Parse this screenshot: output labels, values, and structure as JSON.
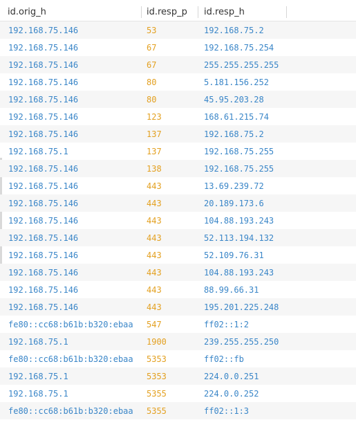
{
  "columns": {
    "orig_h": "id.orig_h",
    "resp_p": "id.resp_p",
    "resp_h": "id.resp_h"
  },
  "colors": {
    "ip": "#3a86c8",
    "port": "#e3a020",
    "header_text": "#333333"
  },
  "rows": [
    {
      "orig_h": "192.168.75.146",
      "resp_p": "53",
      "resp_h": "192.168.75.2"
    },
    {
      "orig_h": "192.168.75.146",
      "resp_p": "67",
      "resp_h": "192.168.75.254"
    },
    {
      "orig_h": "192.168.75.146",
      "resp_p": "67",
      "resp_h": "255.255.255.255"
    },
    {
      "orig_h": "192.168.75.146",
      "resp_p": "80",
      "resp_h": "5.181.156.252"
    },
    {
      "orig_h": "192.168.75.146",
      "resp_p": "80",
      "resp_h": "45.95.203.28"
    },
    {
      "orig_h": "192.168.75.146",
      "resp_p": "123",
      "resp_h": "168.61.215.74"
    },
    {
      "orig_h": "192.168.75.146",
      "resp_p": "137",
      "resp_h": "192.168.75.2"
    },
    {
      "orig_h": "192.168.75.1",
      "resp_p": "137",
      "resp_h": "192.168.75.255"
    },
    {
      "orig_h": "192.168.75.146",
      "resp_p": "138",
      "resp_h": "192.168.75.255"
    },
    {
      "orig_h": "192.168.75.146",
      "resp_p": "443",
      "resp_h": "13.69.239.72"
    },
    {
      "orig_h": "192.168.75.146",
      "resp_p": "443",
      "resp_h": "20.189.173.6"
    },
    {
      "orig_h": "192.168.75.146",
      "resp_p": "443",
      "resp_h": "104.88.193.243"
    },
    {
      "orig_h": "192.168.75.146",
      "resp_p": "443",
      "resp_h": "52.113.194.132"
    },
    {
      "orig_h": "192.168.75.146",
      "resp_p": "443",
      "resp_h": "52.109.76.31"
    },
    {
      "orig_h": "192.168.75.146",
      "resp_p": "443",
      "resp_h": "104.88.193.243"
    },
    {
      "orig_h": "192.168.75.146",
      "resp_p": "443",
      "resp_h": "88.99.66.31"
    },
    {
      "orig_h": "192.168.75.146",
      "resp_p": "443",
      "resp_h": "195.201.225.248"
    },
    {
      "orig_h": "fe80::cc68:b61b:b320:ebaa",
      "resp_p": "547",
      "resp_h": "ff02::1:2"
    },
    {
      "orig_h": "192.168.75.1",
      "resp_p": "1900",
      "resp_h": "239.255.255.250"
    },
    {
      "orig_h": "fe80::cc68:b61b:b320:ebaa",
      "resp_p": "5353",
      "resp_h": "ff02::fb"
    },
    {
      "orig_h": "192.168.75.1",
      "resp_p": "5353",
      "resp_h": "224.0.0.251"
    },
    {
      "orig_h": "192.168.75.1",
      "resp_p": "5355",
      "resp_h": "224.0.0.252"
    },
    {
      "orig_h": "fe80::cc68:b61b:b320:ebaa",
      "resp_p": "5355",
      "resp_h": "ff02::1:3"
    }
  ]
}
